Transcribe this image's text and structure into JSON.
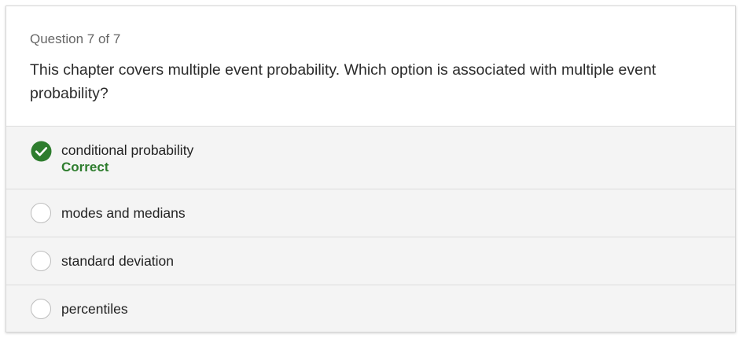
{
  "question": {
    "counter": "Question 7 of 7",
    "text": "This chapter covers multiple event probability. Which option is associated with multiple event probability?"
  },
  "options": [
    {
      "label": "conditional probability",
      "selected": true,
      "feedback": "Correct",
      "icon": "checkmark-circle-icon"
    },
    {
      "label": "modes and medians",
      "selected": false
    },
    {
      "label": "standard deviation",
      "selected": false
    },
    {
      "label": "percentiles",
      "selected": false
    }
  ],
  "colors": {
    "correct": "#2e7d2e",
    "option_background": "#f4f4f4",
    "header_background": "#ffffff"
  }
}
